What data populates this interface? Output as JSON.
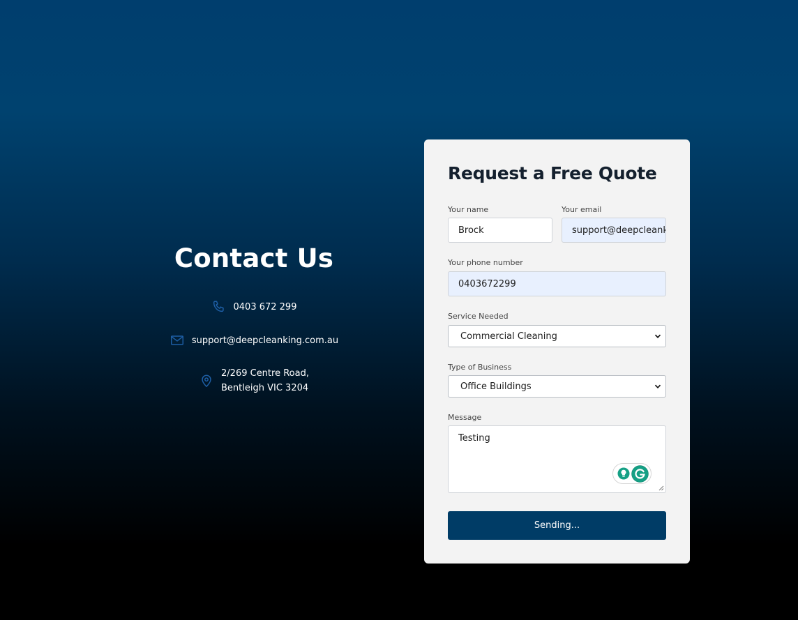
{
  "contact": {
    "title": "Contact Us",
    "phone": "0403 672 299",
    "email": "support@deepcleanking.com.au",
    "address_line1": "2/269 Centre Road,",
    "address_line2": "Bentleigh VIC 3204"
  },
  "form": {
    "title": "Request a Free Quote",
    "name_label": "Your name",
    "name_value": "Brock",
    "email_label": "Your email",
    "email_value": "support@deepcleanking.com.au",
    "phone_label": "Your phone number",
    "phone_value": "0403672299",
    "service_label": "Service Needed",
    "service_value": "Commercial Cleaning",
    "business_label": "Type of Business",
    "business_value": "Office Buildings",
    "message_label": "Message",
    "message_value": "Testing",
    "submit_label": "Sending..."
  },
  "icons": {
    "phone": "phone-icon",
    "email": "mail-icon",
    "location": "location-pin-icon",
    "grammarly_hint": "lightbulb-icon",
    "grammarly": "grammarly-icon"
  },
  "colors": {
    "accent": "#003c66",
    "icon_blue": "#1e5fa6",
    "card_bg": "#f3f3f3",
    "autofill_bg": "#e8f0fe",
    "grammarly_green": "#15a085"
  }
}
